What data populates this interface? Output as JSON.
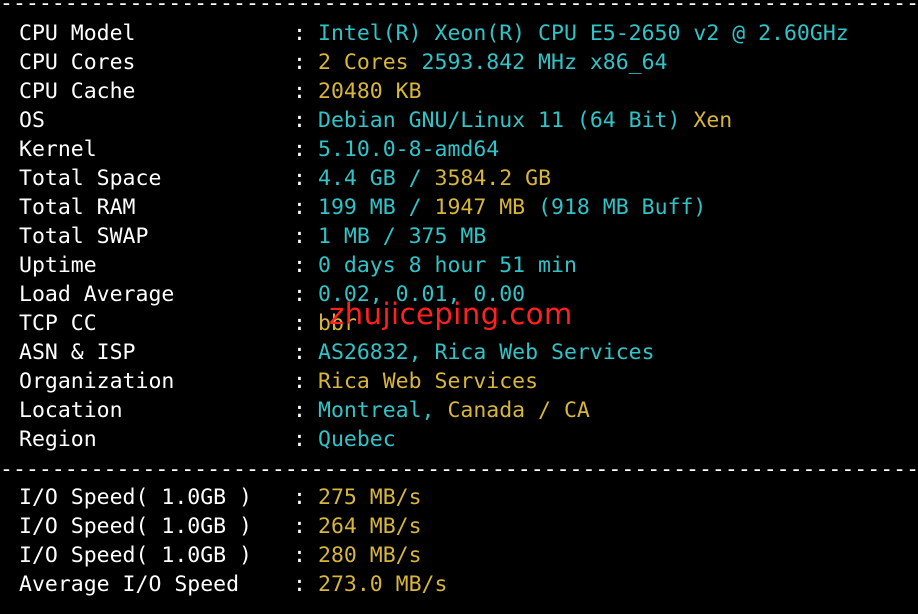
{
  "colors": {
    "background": "#000000",
    "label": "#ffffff",
    "cyan": "#2fc4c8",
    "yellow": "#d7b63a",
    "watermark": "#ff2020"
  },
  "separator": "------------------------------------------------------------------------",
  "colon": ":",
  "info": [
    {
      "label": "CPU Model",
      "parts": [
        {
          "text": "Intel(R) Xeon(R) CPU E5-2650 v2 @ 2.60GHz",
          "color": "cyan"
        }
      ]
    },
    {
      "label": "CPU Cores",
      "parts": [
        {
          "text": "2 Cores",
          "color": "yellow"
        },
        {
          "text": " 2593.842 MHz x86_64",
          "color": "cyan"
        }
      ]
    },
    {
      "label": "CPU Cache",
      "parts": [
        {
          "text": "20480 KB",
          "color": "yellow"
        }
      ]
    },
    {
      "label": "OS",
      "parts": [
        {
          "text": "Debian GNU/Linux 11 (64 Bit)",
          "color": "cyan"
        },
        {
          "text": " Xen",
          "color": "yellow"
        }
      ]
    },
    {
      "label": "Kernel",
      "parts": [
        {
          "text": "5.10.0-8-amd64",
          "color": "cyan"
        }
      ]
    },
    {
      "label": "Total Space",
      "parts": [
        {
          "text": "4.4 GB",
          "color": "cyan"
        },
        {
          "text": " / ",
          "color": "cyan"
        },
        {
          "text": "3584.2 GB",
          "color": "yellow"
        }
      ]
    },
    {
      "label": "Total RAM",
      "parts": [
        {
          "text": "199 MB",
          "color": "cyan"
        },
        {
          "text": " / ",
          "color": "cyan"
        },
        {
          "text": "1947 MB",
          "color": "yellow"
        },
        {
          "text": " (918 MB Buff)",
          "color": "cyan"
        }
      ]
    },
    {
      "label": "Total SWAP",
      "parts": [
        {
          "text": "1 MB / 375 MB",
          "color": "cyan"
        }
      ]
    },
    {
      "label": "Uptime",
      "parts": [
        {
          "text": "0 days 8 hour 51 min",
          "color": "cyan"
        }
      ]
    },
    {
      "label": "Load Average",
      "parts": [
        {
          "text": "0.02, 0.01, 0.00",
          "color": "cyan"
        }
      ]
    },
    {
      "label": "TCP CC",
      "parts": [
        {
          "text": "bbr",
          "color": "yellow"
        }
      ]
    },
    {
      "label": "ASN & ISP",
      "parts": [
        {
          "text": "AS26832, Rica Web Services",
          "color": "cyan"
        }
      ]
    },
    {
      "label": "Organization",
      "parts": [
        {
          "text": "Rica Web Services",
          "color": "yellow"
        }
      ]
    },
    {
      "label": "Location",
      "parts": [
        {
          "text": "Montreal,",
          "color": "cyan"
        },
        {
          "text": " Canada / CA",
          "color": "yellow"
        }
      ]
    },
    {
      "label": "Region",
      "parts": [
        {
          "text": "Quebec",
          "color": "cyan"
        }
      ]
    }
  ],
  "io": [
    {
      "label": "I/O Speed( 1.0GB )",
      "parts": [
        {
          "text": "275 MB/s",
          "color": "yellow"
        }
      ]
    },
    {
      "label": "I/O Speed( 1.0GB )",
      "parts": [
        {
          "text": "264 MB/s",
          "color": "yellow"
        }
      ]
    },
    {
      "label": "I/O Speed( 1.0GB )",
      "parts": [
        {
          "text": "280 MB/s",
          "color": "yellow"
        }
      ]
    },
    {
      "label": "Average I/O Speed",
      "parts": [
        {
          "text": "273.0 MB/s",
          "color": "yellow"
        }
      ]
    }
  ],
  "watermark": "zhujiceping.com"
}
